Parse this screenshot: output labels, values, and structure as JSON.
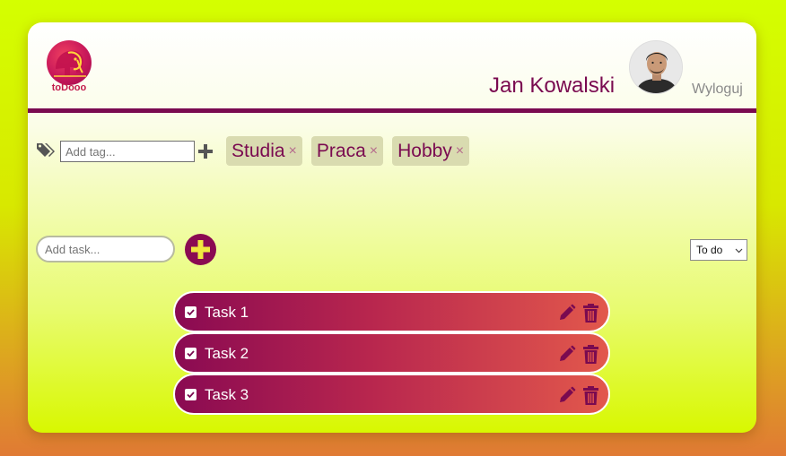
{
  "app": {
    "logo_text": "toDooo"
  },
  "header": {
    "user_name": "Jan Kowalski",
    "logout_label": "Wyloguj"
  },
  "tags": {
    "input_placeholder": "Add tag...",
    "items": [
      {
        "label": "Studia",
        "remove": "×"
      },
      {
        "label": "Praca",
        "remove": "×"
      },
      {
        "label": "Hobby",
        "remove": "×"
      }
    ]
  },
  "tasks": {
    "input_placeholder": "Add task...",
    "filter_selected": "To do",
    "items": [
      {
        "title": "Task 1",
        "done": true
      },
      {
        "title": "Task 2",
        "done": true
      },
      {
        "title": "Task 3",
        "done": true
      }
    ]
  },
  "colors": {
    "brand": "#7a0a50",
    "page_top": "#d4ff00",
    "page_bottom": "#e07a34",
    "task_gradient_start": "#8a0a52",
    "task_gradient_end": "#e2584c"
  }
}
